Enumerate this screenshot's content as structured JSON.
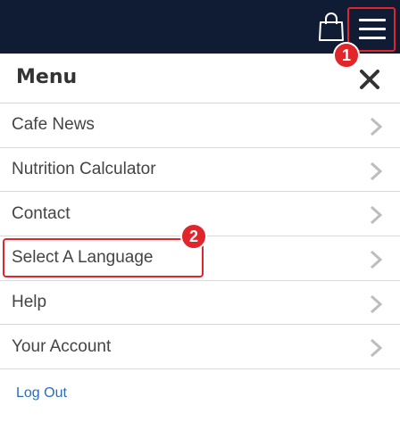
{
  "topbar": {
    "bag_icon": "shopping-bag-icon",
    "menu_icon": "hamburger-menu-icon"
  },
  "menu": {
    "title": "Menu",
    "close_icon": "close-icon",
    "items": [
      {
        "label": "Cafe News"
      },
      {
        "label": "Nutrition Calculator"
      },
      {
        "label": "Contact"
      },
      {
        "label": "Select A Language"
      },
      {
        "label": "Help"
      },
      {
        "label": "Your Account"
      }
    ],
    "logout_label": "Log Out"
  },
  "annotations": {
    "badge_1": "1",
    "badge_2": "2"
  },
  "colors": {
    "topbar": "#0f1c33",
    "callout": "#e0262b",
    "link": "#2a6ebb"
  }
}
